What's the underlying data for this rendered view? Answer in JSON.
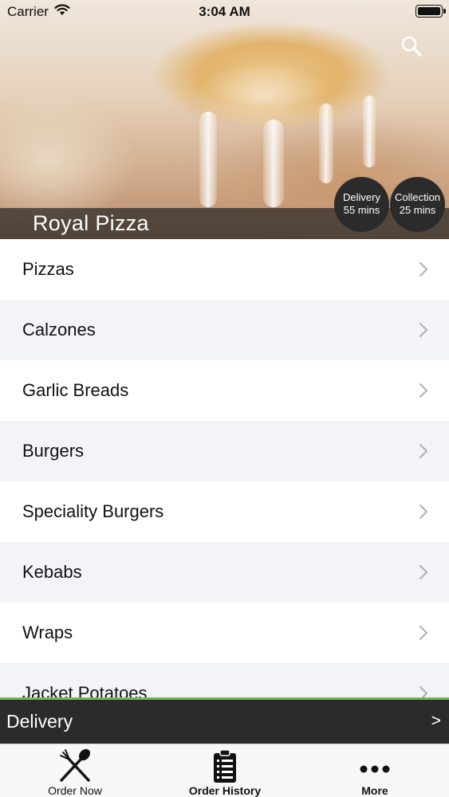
{
  "status_bar": {
    "carrier": "Carrier",
    "time": "3:04 AM"
  },
  "hero": {
    "restaurant_name": "Royal Pizza",
    "delivery": {
      "label": "Delivery",
      "time": "55 mins"
    },
    "collection": {
      "label": "Collection",
      "time": "25 mins"
    },
    "search_icon": "search-icon"
  },
  "menu": {
    "items": [
      {
        "label": "Pizzas"
      },
      {
        "label": "Calzones"
      },
      {
        "label": "Garlic Breads"
      },
      {
        "label": "Burgers"
      },
      {
        "label": "Speciality Burgers"
      },
      {
        "label": "Kebabs"
      },
      {
        "label": "Wraps"
      },
      {
        "label": "Jacket Potatoes"
      }
    ]
  },
  "order_bar": {
    "label": "Delivery",
    "arrow": ">"
  },
  "tabs": [
    {
      "label": "Order Now",
      "icon": "fork-spoon-icon"
    },
    {
      "label": "Order History",
      "icon": "clipboard-list-icon"
    },
    {
      "label": "More",
      "icon": "more-dots-icon"
    }
  ],
  "colors": {
    "accent_green": "#6fbf53",
    "dark_bar": "#2b2b2b",
    "alt_row": "#f2f4f8"
  }
}
